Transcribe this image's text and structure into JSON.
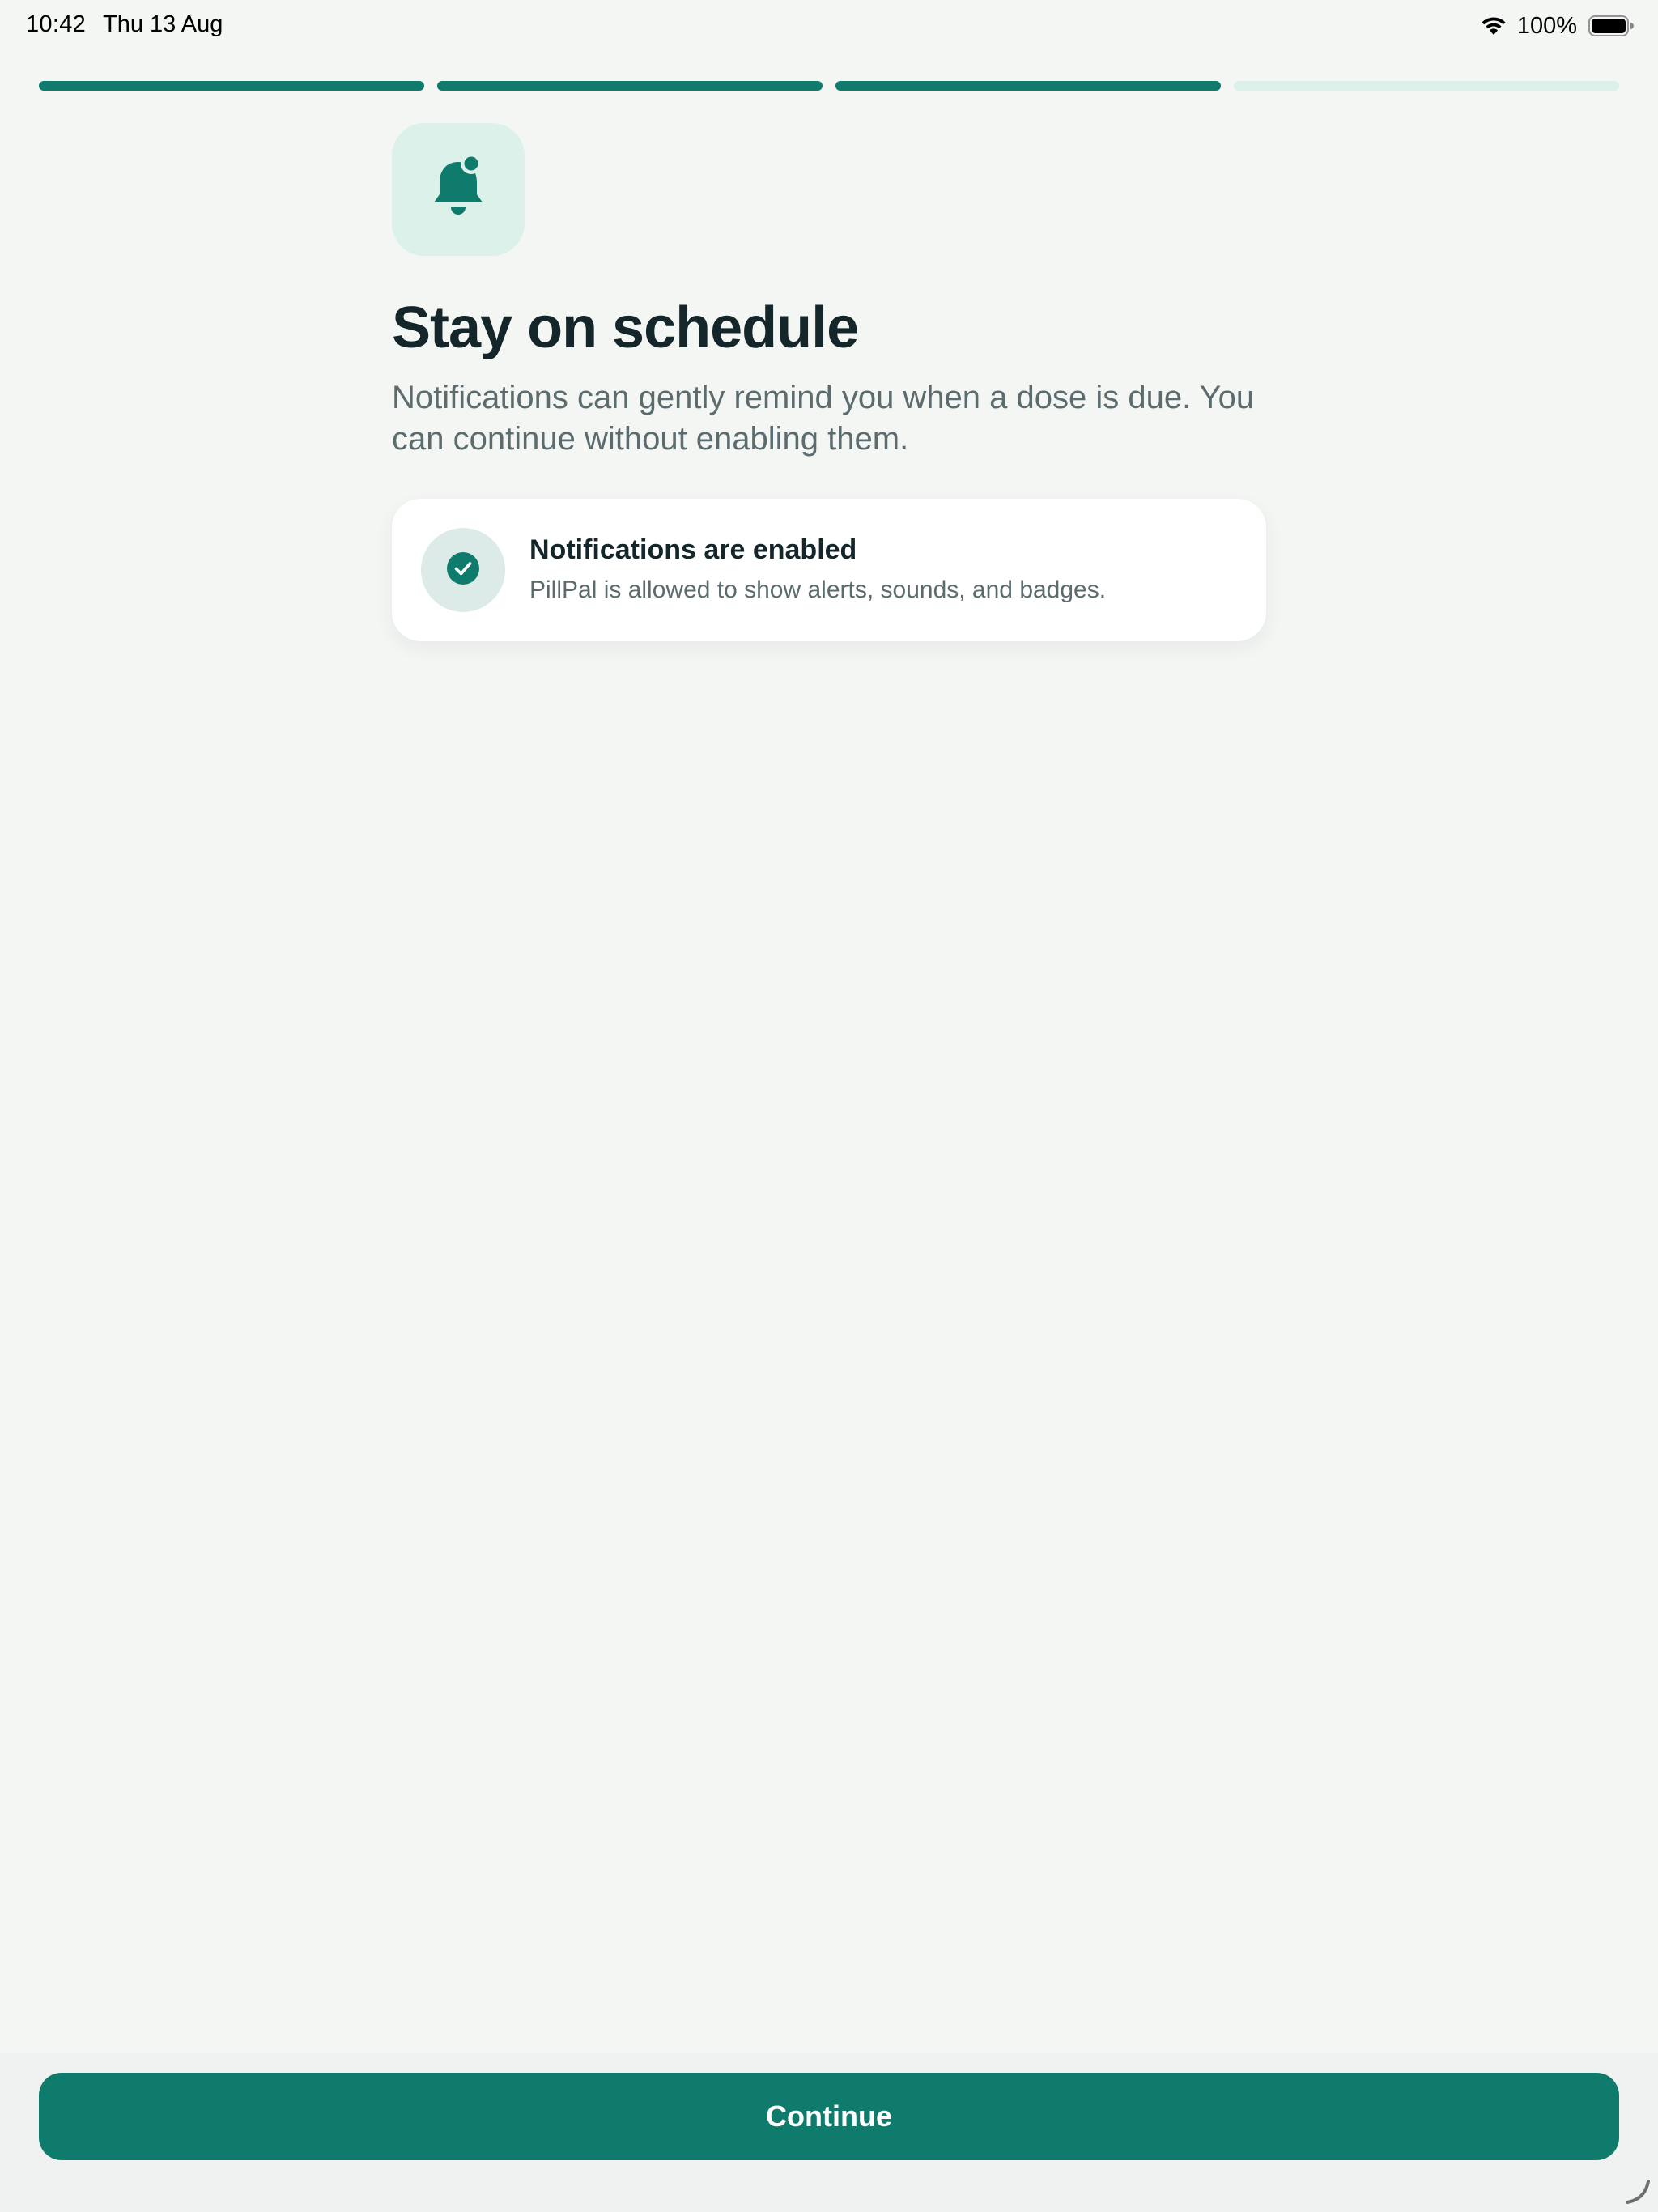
{
  "status_bar": {
    "time": "10:42",
    "date": "Thu 13 Aug",
    "battery_percent": "100%",
    "icons": [
      "wifi-icon",
      "battery-icon"
    ]
  },
  "progress": {
    "total_steps": 4,
    "completed_steps": 3,
    "active_color": "#0f7b6c",
    "inactive_color": "#dcf1e9"
  },
  "hero": {
    "icon": "bell-icon",
    "title": "Stay on schedule",
    "subtitle": "Notifications can gently remind you when a dose is due. You can continue without enabling them."
  },
  "status_card": {
    "icon": "check-circle-icon",
    "title": "Notifications are enabled",
    "description": "PillPal is allowed to show alerts, sounds, and badges."
  },
  "actions": {
    "continue_label": "Continue"
  },
  "colors": {
    "accent": "#0f7b6c",
    "background": "#f4f6f4",
    "text_primary": "#14262a",
    "text_secondary": "#5b6b6e"
  }
}
